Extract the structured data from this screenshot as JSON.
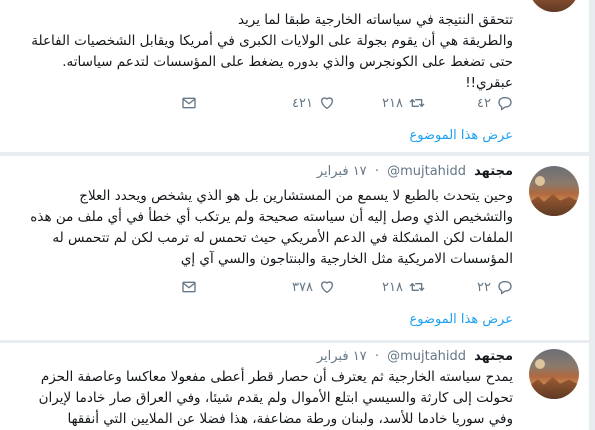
{
  "tweets": [
    {
      "name": "",
      "handle": "",
      "date": "",
      "lines": [
        "تتحقق النتيجة في سياساته الخارجية طبقا لما يريد",
        "والطريقة هي أن يقوم بجولة على الولايات الكبرى في أمريكا ويقابل الشخصيات الفاعلة",
        "حتى تضغط على الكونجرس والذي بدوره يضغط على المؤسسات لتدعم سياساته.",
        "عبقري!!"
      ],
      "replies": "٤٢",
      "retweets": "٢١٨",
      "likes": "٤٢١",
      "show_thread": "عرض هذا الموضوع"
    },
    {
      "name": "مجتهد",
      "handle": "@mujtahidd",
      "date": "١٧ فبراير",
      "lines": [
        "وحين يتحدث بالطبع لا يسمع من المستشارين بل هو الذي يشخص ويحدد العلاج",
        "والتشخيص الذي وصل إليه أن سياسته صحيحة ولم يرتكب أي خطأ في أي ملف من هذه",
        "الملفات لكن المشكلة في الدعم الأمريكي حيث تحمس له ترمب لكن لم تتحمس له",
        "المؤسسات الامريكية مثل الخارجية والبنتاجون والسي آي إي"
      ],
      "replies": "٢٢",
      "retweets": "٢١٨",
      "likes": "٣٧٨",
      "show_thread": "عرض هذا الموضوع"
    },
    {
      "name": "مجتهد",
      "handle": "@mujtahidd",
      "date": "١٧ فبراير",
      "lines": [
        "يمدح سياسته الخارجية ثم يعترف أن حصار قطر أعطى مفعولا معاكسا وعاصفة الحزم",
        "تحولت إلى كارثة والسيسي ابتلع الأموال ولم يقدم شيئا، وفي العراق صار خادما لإيران",
        "وفي سوريا خادما للأسد، ولبنان ورطة مضاعفة، هذا فضلا عن الملايين التي أنفقها"
      ]
    }
  ],
  "icons": {
    "reply": "reply-icon",
    "retweet": "retweet-icon",
    "like": "heart-icon",
    "dm": "envelope-icon"
  },
  "colors": {
    "accent": "#1da1f2",
    "secondary_text": "#657786",
    "divider": "#e6ecf0"
  }
}
